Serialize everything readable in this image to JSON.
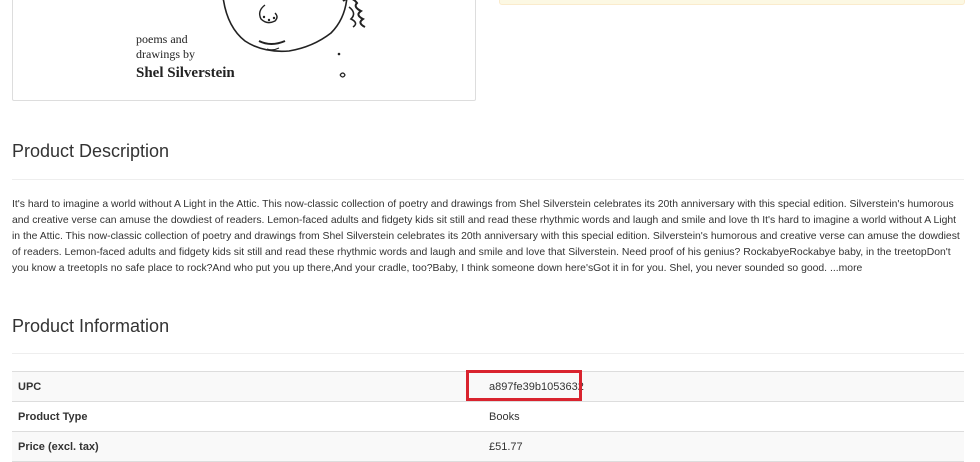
{
  "cover": {
    "line1": "poems and",
    "line2": "drawings by",
    "author": "Shel Silverstein"
  },
  "description": {
    "heading": "Product Description",
    "text": "It's hard to imagine a world without A Light in the Attic. This now-classic collection of poetry and drawings from Shel Silverstein celebrates its 20th anniversary with this special edition. Silverstein's humorous and creative verse can amuse the dowdiest of readers. Lemon-faced adults and fidgety kids sit still and read these rhythmic words and laugh and smile and love th It's hard to imagine a world without A Light in the Attic. This now-classic collection of poetry and drawings from Shel Silverstein celebrates its 20th anniversary with this special edition. Silverstein's humorous and creative verse can amuse the dowdiest of readers. Lemon-faced adults and fidgety kids sit still and read these rhythmic words and laugh and smile and love that Silverstein. Need proof of his genius? RockabyeRockabye baby, in the treetopDon't you know a treetopIs no safe place to rock?And who put you up there,And your cradle, too?Baby, I think someone down here'sGot it in for you. Shel, you never sounded so good. ",
    "more_label": "...more"
  },
  "info": {
    "heading": "Product Information",
    "rows": [
      {
        "label": "UPC",
        "value": "a897fe39b1053632"
      },
      {
        "label": "Product Type",
        "value": "Books"
      },
      {
        "label": "Price (excl. tax)",
        "value": "£51.77"
      }
    ]
  },
  "colors": {
    "highlight": "#d9232e",
    "alert_bg": "#fcf8e3"
  }
}
